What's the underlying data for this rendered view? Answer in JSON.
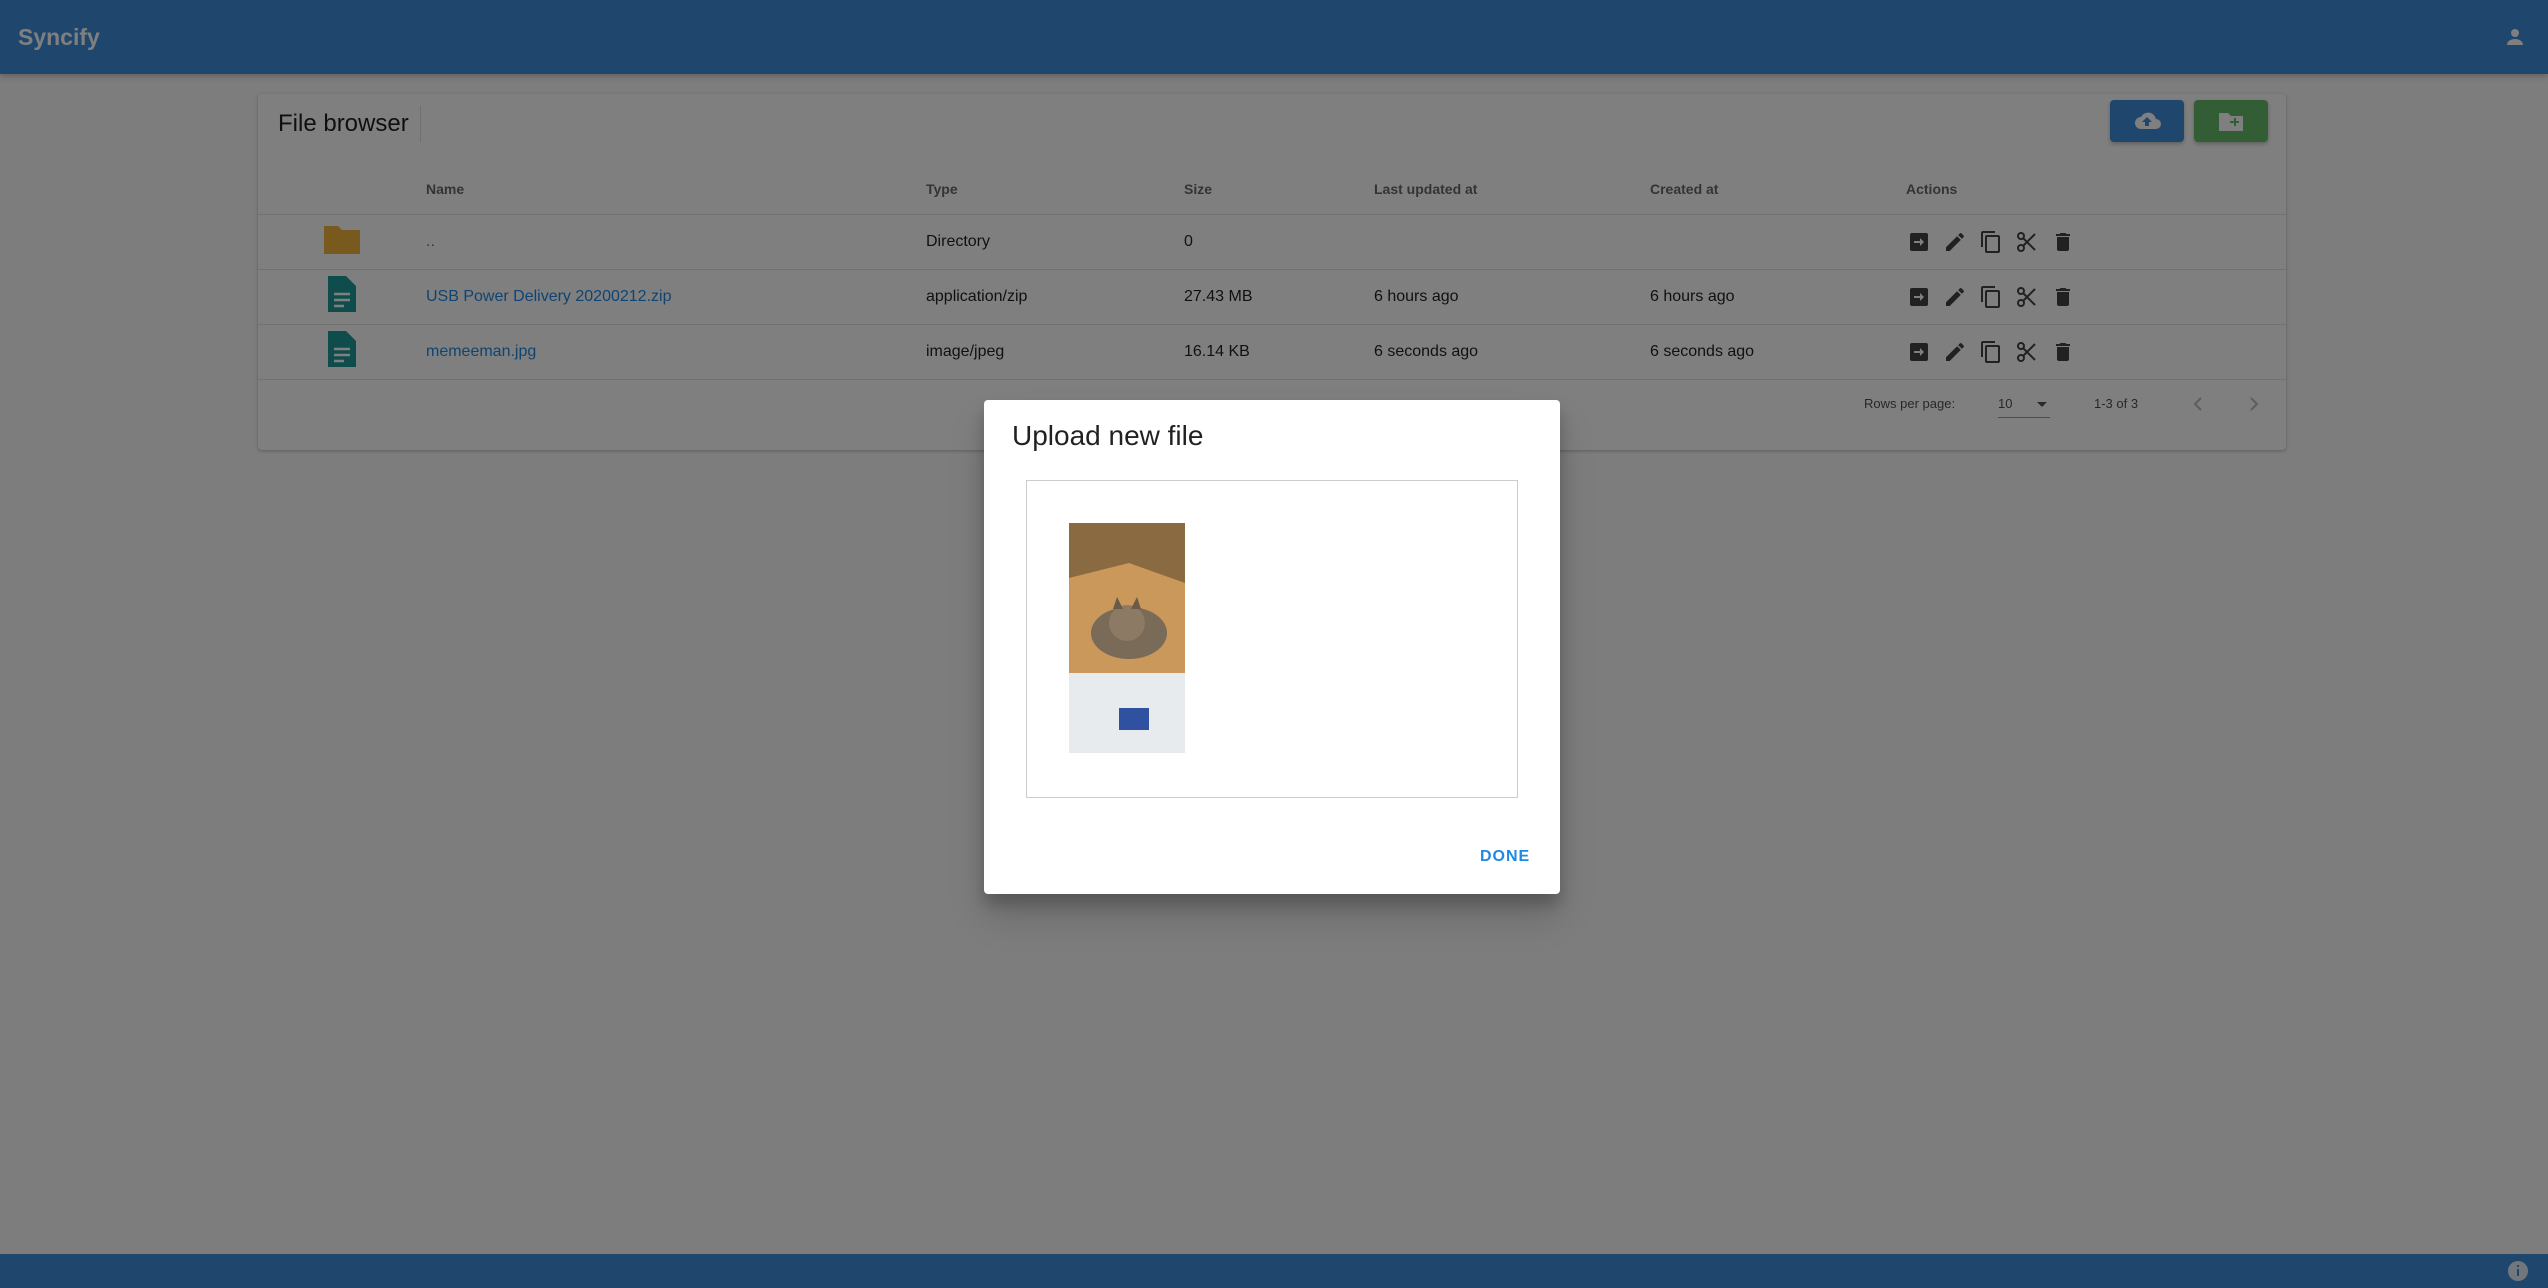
{
  "app": {
    "title": "Syncify"
  },
  "page": {
    "title": "File browser"
  },
  "table": {
    "headers": {
      "name": "Name",
      "type": "Type",
      "size": "Size",
      "updated": "Last updated at",
      "created": "Created at",
      "actions": "Actions"
    },
    "rows": [
      {
        "icon": "folder-icon",
        "name": "..",
        "type": "Directory",
        "size": "0",
        "updated": "",
        "created": ""
      },
      {
        "icon": "file-document-icon",
        "name": "USB Power Delivery 20200212.zip",
        "type": "application/zip",
        "size": "27.43 MB",
        "updated": "6 hours ago",
        "created": "6 hours ago"
      },
      {
        "icon": "file-document-icon",
        "name": "memeeman.jpg",
        "type": "image/jpeg",
        "size": "16.14 KB",
        "updated": "6 seconds ago",
        "created": "6 seconds ago"
      }
    ]
  },
  "pagination": {
    "rows_per_page_label": "Rows per page:",
    "rows_per_page": "10",
    "range": "1-3 of 3"
  },
  "dialog": {
    "title": "Upload new file",
    "done_label": "DONE"
  },
  "colors": {
    "primary": "#3f8fdc",
    "success": "#66bb6a",
    "folder": "#f0b43c",
    "file": "#1e9a9a",
    "link": "#1e88e5"
  }
}
